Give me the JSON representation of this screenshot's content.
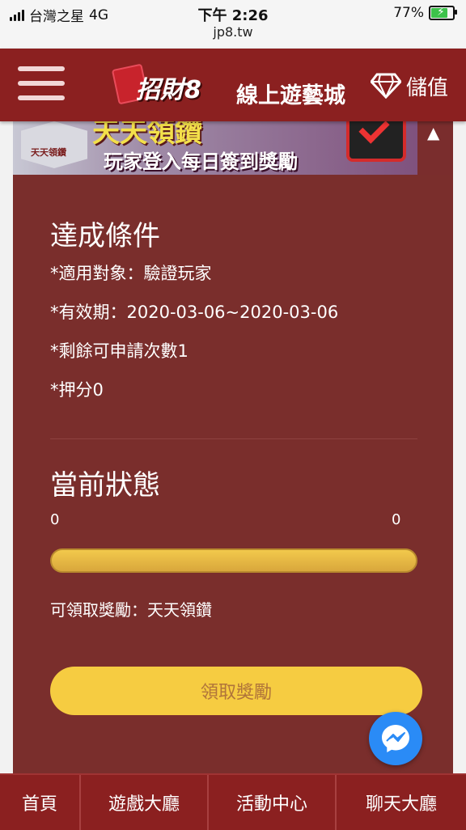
{
  "status_bar": {
    "carrier": "台灣之星",
    "network": "4G",
    "time": "下午 2:26",
    "url": "jp8.tw",
    "battery_percent": "77%",
    "battery_level": 0.77
  },
  "header": {
    "logo_text": "招財8",
    "subtitle": "線上遊藝城",
    "topup_label": "儲值"
  },
  "banner": {
    "badge": "天天領鑽",
    "title": "天天領鑽",
    "subtitle": "玩家登入每日簽到獎勵"
  },
  "conditions": {
    "title": "達成條件",
    "target": "*適用對象：驗證玩家",
    "validity": "*有效期：2020-03-06~2020-03-06",
    "remaining": "*剩餘可申請次數1",
    "deposit": "*押分0"
  },
  "status": {
    "title": "當前狀態",
    "current": "0",
    "goal": "0",
    "progress": 1.0,
    "reward_text": "可領取獎勵：天天領鑽",
    "claim_label": "領取獎勵"
  },
  "nav": {
    "home": "首頁",
    "games": "遊戲大廳",
    "events": "活動中心",
    "chat": "聊天大廳"
  },
  "colors": {
    "header": "#8b2020",
    "card": "#7a2e2c",
    "progress": "#e3b444",
    "button": "#f6cc41",
    "messenger": "#2a8bf6"
  }
}
